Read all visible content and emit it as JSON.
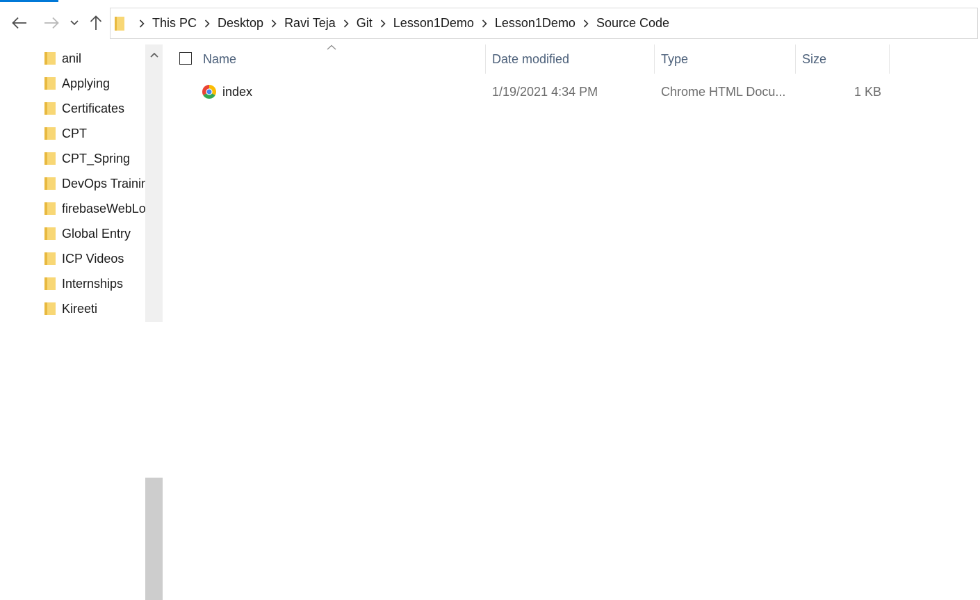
{
  "nav": {
    "back_icon": "arrow-left-icon",
    "forward_icon": "arrow-right-icon",
    "recent_icon": "chevron-down-icon",
    "up_icon": "arrow-up-icon"
  },
  "breadcrumb": [
    "This PC",
    "Desktop",
    "Ravi Teja",
    "Git",
    "Lesson1Demo",
    "Lesson1Demo",
    "Source Code"
  ],
  "sidebar": {
    "items": [
      {
        "label": "anil"
      },
      {
        "label": "Applying"
      },
      {
        "label": "Certificates"
      },
      {
        "label": "CPT"
      },
      {
        "label": "CPT_Spring"
      },
      {
        "label": "DevOps Trainin"
      },
      {
        "label": "firebaseWebLo"
      },
      {
        "label": "Global Entry"
      },
      {
        "label": "ICP Videos"
      },
      {
        "label": "Internships"
      },
      {
        "label": "Kireeti"
      }
    ]
  },
  "columns": {
    "name": "Name",
    "date": "Date modified",
    "type": "Type",
    "size": "Size"
  },
  "files": [
    {
      "name": "index",
      "date": "1/19/2021 4:34 PM",
      "type": "Chrome HTML Docu...",
      "size": "1 KB",
      "icon": "chrome-icon"
    }
  ],
  "colors": {
    "accent": "#0078d7",
    "folder": "#f8d775",
    "header_text": "#4c607a"
  }
}
